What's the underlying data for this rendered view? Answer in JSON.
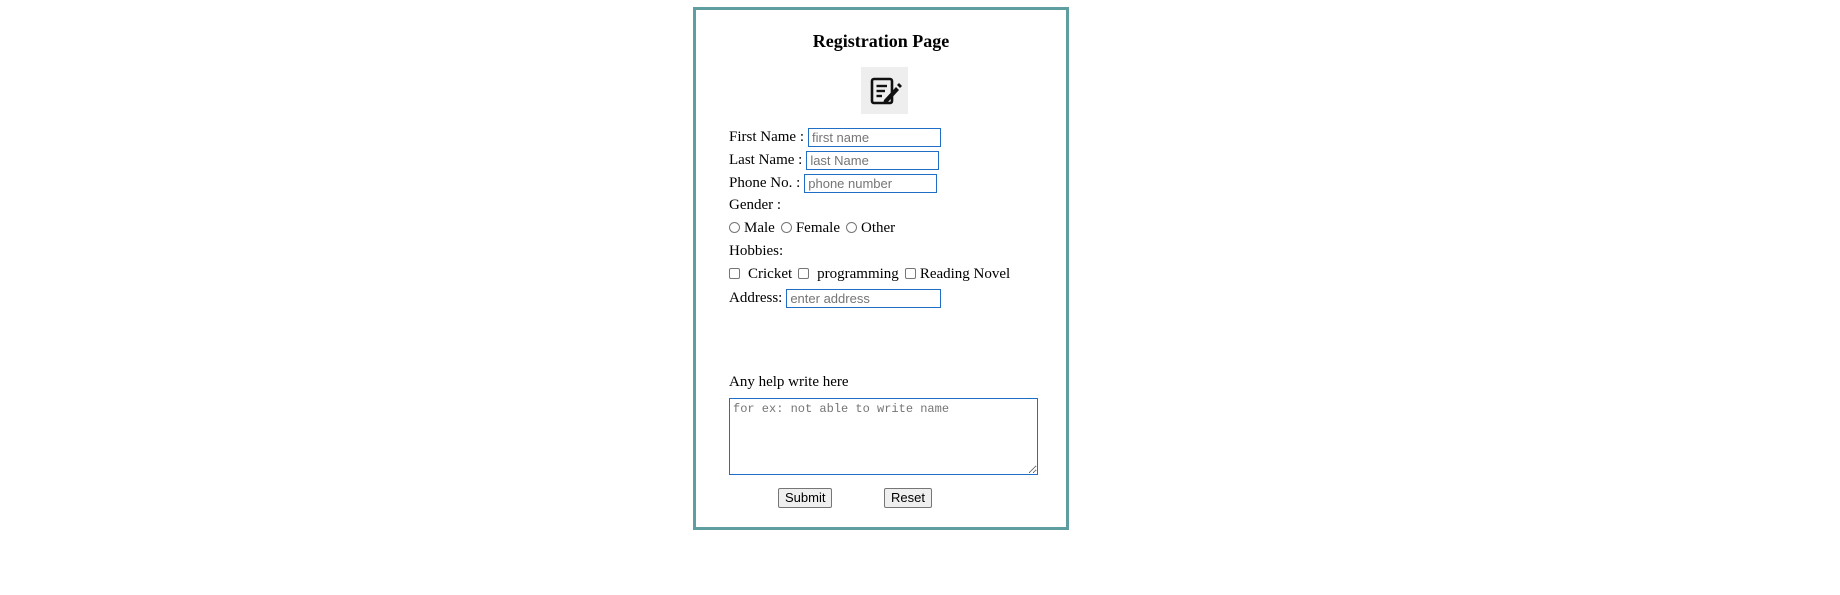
{
  "form": {
    "title": "Registration Page",
    "logo_icon": "edit-document-icon",
    "first_name": {
      "label": "First Name :",
      "placeholder": "first name",
      "value": ""
    },
    "last_name": {
      "label": "Last Name :",
      "placeholder": "last Name",
      "value": ""
    },
    "phone": {
      "label": "Phone No. :",
      "placeholder": "phone number",
      "value": ""
    },
    "gender": {
      "label": "Gender :",
      "options": [
        {
          "label": "Male",
          "checked": false
        },
        {
          "label": "Female",
          "checked": false
        },
        {
          "label": "Other",
          "checked": false
        }
      ]
    },
    "hobbies": {
      "label": "Hobbies:",
      "options": [
        {
          "label": "Cricket",
          "checked": false
        },
        {
          "label": "programming",
          "checked": false
        },
        {
          "label": "Reading Novel",
          "checked": false
        }
      ]
    },
    "address": {
      "label": "Address:",
      "placeholder": "enter address",
      "value": ""
    },
    "help": {
      "label": "Any help write here",
      "placeholder": "for ex: not able to write name",
      "value": ""
    },
    "submit_label": "Submit",
    "reset_label": "Reset"
  },
  "colors": {
    "card_border": "#5f9ea0",
    "input_border": "#1f6fc7",
    "placeholder": "#757575",
    "button_bg": "#efefef"
  }
}
